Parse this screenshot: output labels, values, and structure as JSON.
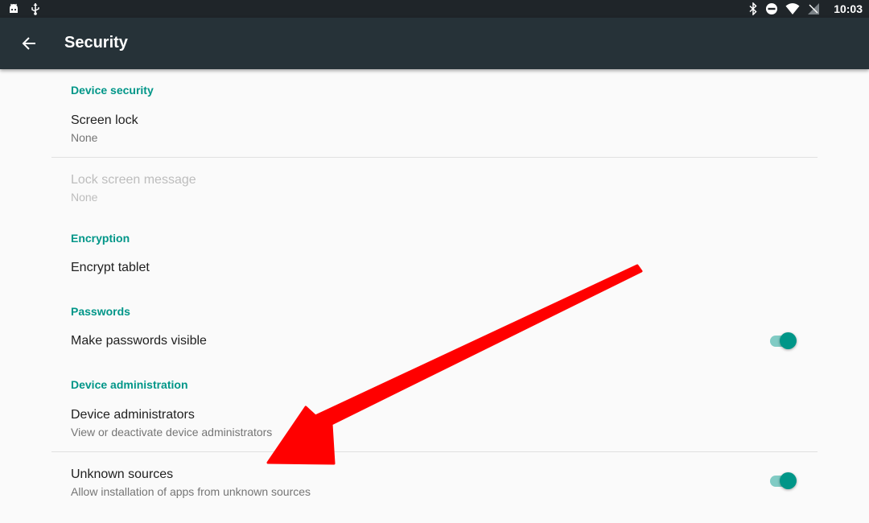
{
  "status_bar": {
    "time": "10:03",
    "left_icons": [
      "android-icon",
      "usb-icon"
    ],
    "right_icons": [
      "bluetooth-icon",
      "do-not-disturb-icon",
      "wifi-icon",
      "no-signal-icon"
    ]
  },
  "toolbar": {
    "back_icon": "arrow-back-icon",
    "title": "Security",
    "background": "#263238"
  },
  "sections": {
    "device_security": {
      "header": "Device security",
      "screen_lock": {
        "title": "Screen lock",
        "summary": "None"
      },
      "lock_message": {
        "title": "Lock screen message",
        "summary": "None",
        "enabled": false
      }
    },
    "encryption": {
      "header": "Encryption",
      "encrypt": {
        "title": "Encrypt tablet"
      }
    },
    "passwords": {
      "header": "Passwords",
      "visible": {
        "title": "Make passwords visible",
        "toggle_on": true
      }
    },
    "device_admin": {
      "header": "Device administration",
      "admins": {
        "title": "Device administrators",
        "summary": "View or deactivate device administrators"
      },
      "unknown": {
        "title": "Unknown sources",
        "summary": "Allow installation of apps from unknown sources",
        "toggle_on": true
      }
    }
  },
  "annotation": {
    "type": "arrow",
    "color": "#ff0000",
    "points_to": "Unknown sources"
  },
  "colors": {
    "accent": "#009688",
    "toggle_track": "#80cbc4",
    "background": "#fafafa"
  }
}
